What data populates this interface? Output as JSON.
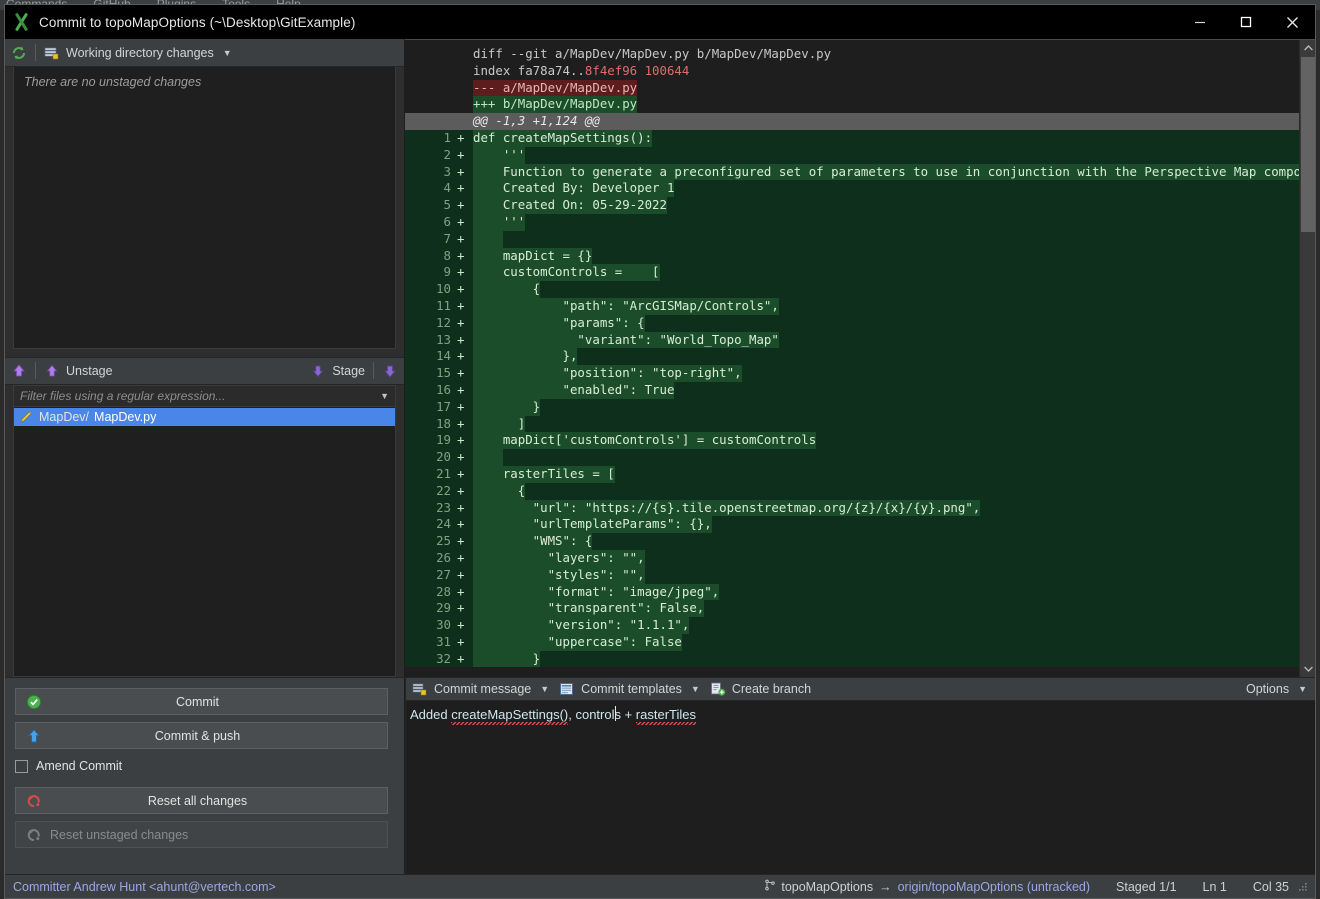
{
  "bg_menubar": {
    "items": [
      "Commands",
      "GitHub",
      "Plugins",
      "Tools",
      "Help"
    ]
  },
  "window": {
    "title": "Commit to topoMapOptions (~\\Desktop\\GitExample)",
    "logo_icon": "git-extensions-logo-icon",
    "controls": [
      {
        "name": "minimize-button",
        "icon": "minimize-icon"
      },
      {
        "name": "maximize-button",
        "icon": "maximize-icon"
      },
      {
        "name": "close-button",
        "icon": "close-icon"
      }
    ]
  },
  "left_panel": {
    "toolbar": {
      "refresh_icon": "refresh-icon",
      "source_icon": "working-directory-icon",
      "label": "Working directory changes",
      "dropdown_icon": "chevron-down-icon"
    },
    "unstaged_empty_text": "There are no unstaged changes",
    "stage_toolbar": {
      "unstage_all_icon": "unstage-all-icon",
      "unstage_icon": "unstage-icon",
      "unstage_label": "Unstage",
      "stage_icon": "stage-icon",
      "stage_label": "Stage",
      "stage_all_icon": "stage-all-icon"
    },
    "filter": {
      "placeholder": "Filter files using a regular expression...",
      "dropdown_icon": "chevron-down-icon"
    },
    "staged_files": [
      {
        "icon": "modified-file-icon",
        "dir": "MapDev/",
        "name": "MapDev.py",
        "selected": true
      }
    ]
  },
  "commit_actions": {
    "commit": {
      "label": "Commit",
      "icon": "check-circle-icon"
    },
    "commit_push": {
      "label": "Commit & push",
      "icon": "up-arrow-icon"
    },
    "amend": {
      "label": "Amend Commit",
      "checked": false
    },
    "reset_all": {
      "label": "Reset all changes",
      "icon": "reset-red-icon"
    },
    "reset_unstaged": {
      "label": "Reset unstaged changes",
      "icon": "reset-gray-icon",
      "disabled": true
    }
  },
  "commit_message_pane": {
    "toolbar": {
      "commit_message": {
        "label": "Commit message",
        "icon": "commit-message-icon",
        "dropdown_icon": "chevron-down-icon"
      },
      "commit_templates": {
        "label": "Commit templates",
        "icon": "commit-template-icon",
        "dropdown_icon": "chevron-down-icon"
      },
      "create_branch": {
        "label": "Create branch",
        "icon": "create-branch-icon"
      },
      "options": {
        "label": "Options",
        "dropdown_icon": "chevron-down-icon"
      }
    },
    "message_value": "Added createMapSettings(), controls + rasterTiles",
    "caret_col": 35
  },
  "diff": {
    "scrollbar": {
      "up_icon": "chevron-up-icon",
      "down_icon": "chevron-down-icon"
    },
    "lines": [
      {
        "kind": "meta",
        "num": "",
        "sign": "",
        "text": "diff --git a/MapDev/MapDev.py b/MapDev/MapDev.py"
      },
      {
        "kind": "index",
        "num": "",
        "sign": "",
        "text": "index fa78a74..8f4ef96 100644",
        "pre": "index fa78a74..",
        "hash": "8f4ef96 100644"
      },
      {
        "kind": "del",
        "num": "",
        "sign": "",
        "text": "--- a/MapDev/MapDev.py"
      },
      {
        "kind": "add-hdr",
        "num": "",
        "sign": "",
        "text": "+++ b/MapDev/MapDev.py"
      },
      {
        "kind": "hunk",
        "num": "",
        "sign": "",
        "text": "@@ -1,3 +1,124 @@"
      },
      {
        "kind": "plus",
        "num": "1",
        "sign": "+",
        "text": "def createMapSettings():"
      },
      {
        "kind": "plus",
        "num": "2",
        "sign": "+",
        "text": "    '''"
      },
      {
        "kind": "plus",
        "num": "3",
        "sign": "+",
        "text": "    Function to generate a preconfigured set of parameters to use in conjunction with the Perspective Map component"
      },
      {
        "kind": "plus",
        "num": "4",
        "sign": "+",
        "text": "    Created By: Developer 1"
      },
      {
        "kind": "plus",
        "num": "5",
        "sign": "+",
        "text": "    Created On: 05-29-2022"
      },
      {
        "kind": "plus",
        "num": "6",
        "sign": "+",
        "text": "    '''"
      },
      {
        "kind": "plus",
        "num": "7",
        "sign": "+",
        "text": "    "
      },
      {
        "kind": "plus",
        "num": "8",
        "sign": "+",
        "text": "    mapDict = {}"
      },
      {
        "kind": "plus",
        "num": "9",
        "sign": "+",
        "text": "    customControls =    ["
      },
      {
        "kind": "plus",
        "num": "10",
        "sign": "+",
        "text": "        {"
      },
      {
        "kind": "plus",
        "num": "11",
        "sign": "+",
        "text": "            \"path\": \"ArcGISMap/Controls\","
      },
      {
        "kind": "plus",
        "num": "12",
        "sign": "+",
        "text": "            \"params\": {"
      },
      {
        "kind": "plus",
        "num": "13",
        "sign": "+",
        "text": "              \"variant\": \"World_Topo_Map\""
      },
      {
        "kind": "plus",
        "num": "14",
        "sign": "+",
        "text": "            },"
      },
      {
        "kind": "plus",
        "num": "15",
        "sign": "+",
        "text": "            \"position\": \"top-right\","
      },
      {
        "kind": "plus",
        "num": "16",
        "sign": "+",
        "text": "            \"enabled\": True"
      },
      {
        "kind": "plus",
        "num": "17",
        "sign": "+",
        "text": "        }"
      },
      {
        "kind": "plus",
        "num": "18",
        "sign": "+",
        "text": "      ]"
      },
      {
        "kind": "plus",
        "num": "19",
        "sign": "+",
        "text": "    mapDict['customControls'] = customControls"
      },
      {
        "kind": "plus",
        "num": "20",
        "sign": "+",
        "text": "    "
      },
      {
        "kind": "plus",
        "num": "21",
        "sign": "+",
        "text": "    rasterTiles = ["
      },
      {
        "kind": "plus",
        "num": "22",
        "sign": "+",
        "text": "      {"
      },
      {
        "kind": "plus",
        "num": "23",
        "sign": "+",
        "text": "        \"url\": \"https://{s}.tile.openstreetmap.org/{z}/{x}/{y}.png\","
      },
      {
        "kind": "plus",
        "num": "24",
        "sign": "+",
        "text": "        \"urlTemplateParams\": {},"
      },
      {
        "kind": "plus",
        "num": "25",
        "sign": "+",
        "text": "        \"WMS\": {"
      },
      {
        "kind": "plus",
        "num": "26",
        "sign": "+",
        "text": "          \"layers\": \"\","
      },
      {
        "kind": "plus",
        "num": "27",
        "sign": "+",
        "text": "          \"styles\": \"\","
      },
      {
        "kind": "plus",
        "num": "28",
        "sign": "+",
        "text": "          \"format\": \"image/jpeg\","
      },
      {
        "kind": "plus",
        "num": "29",
        "sign": "+",
        "text": "          \"transparent\": False,"
      },
      {
        "kind": "plus",
        "num": "30",
        "sign": "+",
        "text": "          \"version\": \"1.1.1\","
      },
      {
        "kind": "plus",
        "num": "31",
        "sign": "+",
        "text": "          \"uppercase\": False"
      },
      {
        "kind": "plus",
        "num": "32",
        "sign": "+",
        "text": "        }"
      }
    ]
  },
  "statusbar": {
    "committer": "Committer Andrew Hunt <ahunt@vertech.com>",
    "branch_icon": "branch-icon",
    "branch": "topoMapOptions",
    "arrow": "→",
    "remote": "origin/topoMapOptions (untracked)",
    "staged": "Staged  1/1",
    "line": "Ln  1",
    "col": "Col  35"
  },
  "colors": {
    "accent_blue": "#4a86e8",
    "add_green": "#1b4d2a",
    "add_bg": "#0e2f1c",
    "del_red": "#5e1d1d",
    "toolbar_bg": "#3c3f41",
    "window_bg": "#2e2e2e",
    "editor_bg": "#1e1e1e"
  }
}
